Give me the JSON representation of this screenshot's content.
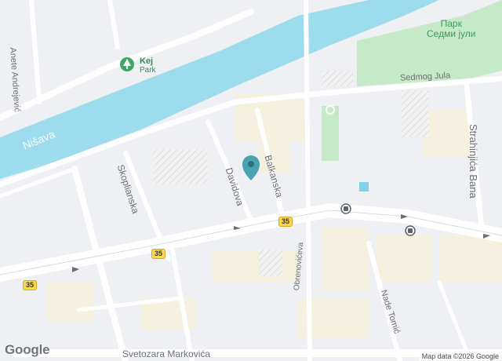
{
  "map": {
    "river": "Nišava",
    "park": {
      "line1": "Парк",
      "line2": "Седми јули"
    },
    "poi": {
      "name": "Kej",
      "category": "Park",
      "icon": "tree-icon"
    },
    "streets": {
      "anete": "Anete Andrejević",
      "sedmog": "Sedmog Jula",
      "strahinjica": "Strahinjića Bana",
      "skoplianska": "Skoplianska",
      "davidova": "Davidova",
      "balkanska": "Balkanska",
      "obrenoviceva": "Obrenovićeva",
      "nade": "Nade Tomić",
      "svetozara": "Svetozara Markovića"
    },
    "route_number": "35",
    "pin": {
      "icon": "location-pin-icon"
    },
    "transit": {
      "icon": "bus-stop-icon"
    },
    "attribution": "Map data ©2026 Google",
    "logo": "Google",
    "colors": {
      "water": "#9ddcec",
      "park": "#c6e9c8",
      "road": "#ffffff",
      "pin": "#4aa3b0",
      "shield": "#fbd650"
    }
  }
}
